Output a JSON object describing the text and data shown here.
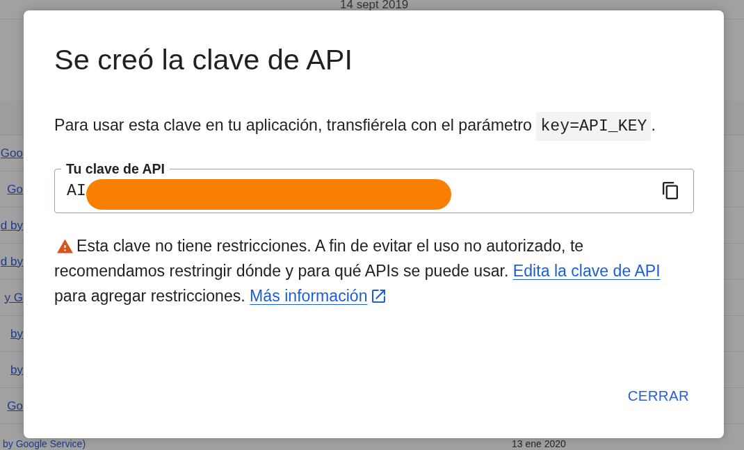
{
  "background": {
    "date_top": "14 sept 2019",
    "rows": [
      {
        "link": "Goo"
      },
      {
        "link": "Go"
      },
      {
        "link": "d by"
      },
      {
        "link": "d by"
      },
      {
        "link": "y G"
      },
      {
        "link": "by"
      },
      {
        "link": "by"
      },
      {
        "link": "Go"
      }
    ],
    "last_row": {
      "link": "by Google Service)",
      "date": "13 ene 2020"
    }
  },
  "dialog": {
    "title": "Se creó la clave de API",
    "instruction": {
      "text": "Para usar esta clave en tu aplicación, transfiérela con el parámetro",
      "code": "key=API_KEY",
      "end": "."
    },
    "key_field": {
      "label": "Tu clave de API",
      "value": "AI",
      "redacted": true
    },
    "warning": {
      "text_before": "Esta clave no tiene restricciones. A fin de evitar el uso no autorizado, te recomendamos restringir dónde y para qué APIs se puede usar.",
      "edit_link": "Edita la clave de API",
      "text_after": "para agregar restricciones.",
      "learn_more_link": "Más información"
    },
    "buttons": [
      {
        "label": "CERRAR"
      }
    ]
  }
}
